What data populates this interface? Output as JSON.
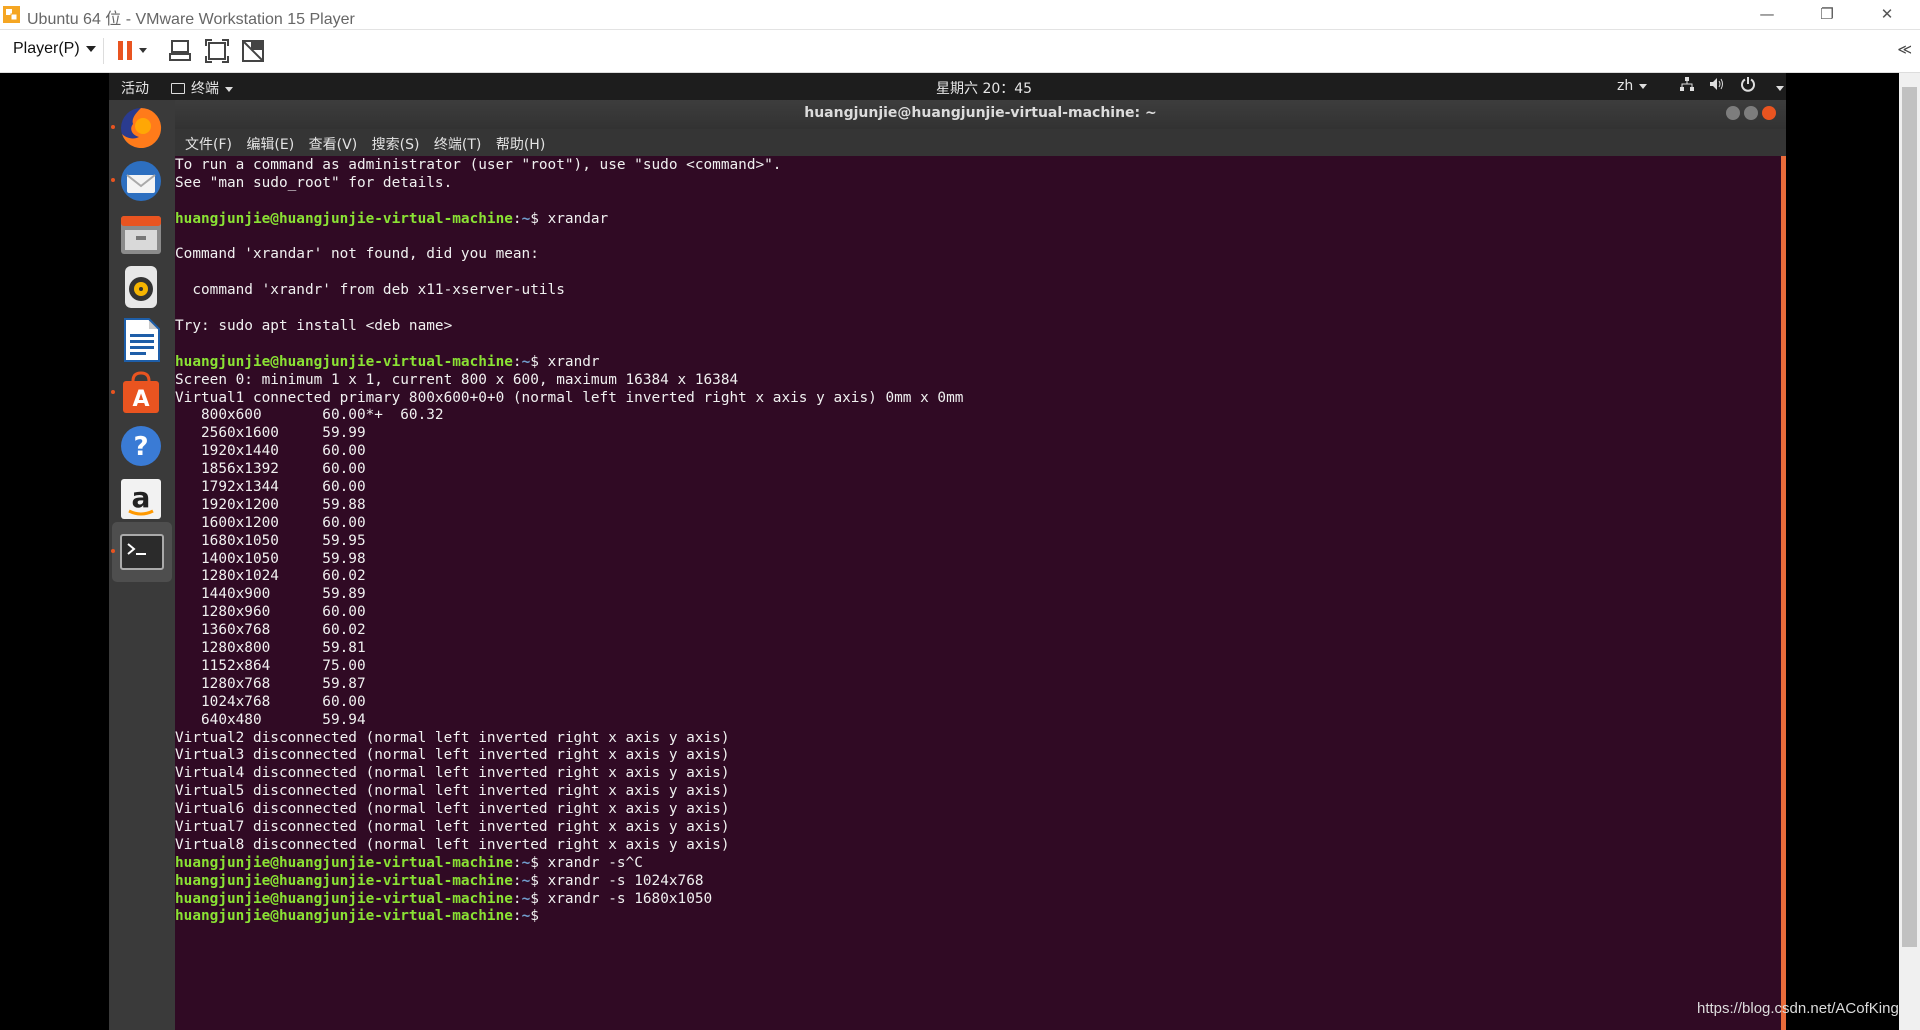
{
  "host": {
    "title": "Ubuntu 64 位 - VMware Workstation 15 Player",
    "player_menu": "Player(P)",
    "win_minimize": "—",
    "win_restore": "❐",
    "win_close": "✕",
    "collapse": "≪"
  },
  "topbar": {
    "activities": "活动",
    "app": "终端",
    "clock": "星期六 20：45",
    "lang": "zh"
  },
  "dock": [
    "firefox-icon",
    "thunderbird-icon",
    "files-icon",
    "rhythmbox-icon",
    "libreoffice-writer-icon",
    "software-center-icon",
    "help-icon",
    "amazon-icon",
    "terminal-icon"
  ],
  "terminal": {
    "title": "huangjunjie@huangjunjie-virtual-machine: ~",
    "menu": [
      "文件(F)",
      "编辑(E)",
      "查看(V)",
      "搜索(S)",
      "终端(T)",
      "帮助(H)"
    ],
    "user_host": "huangjunjie@huangjunjie-virtual-machine",
    "path": "~",
    "lines": [
      {
        "text": "To run a command as administrator (user \"root\"), use \"sudo <command>\"."
      },
      {
        "text": "See \"man sudo_root\" for details."
      },
      {
        "text": ""
      },
      {
        "prompt": true,
        "text": "xrandar"
      },
      {
        "text": ""
      },
      {
        "text": "Command 'xrandar' not found, did you mean:"
      },
      {
        "text": ""
      },
      {
        "text": "  command 'xrandr' from deb x11-xserver-utils"
      },
      {
        "text": ""
      },
      {
        "text": "Try: sudo apt install <deb name>"
      },
      {
        "text": ""
      },
      {
        "prompt": true,
        "text": "xrandr"
      },
      {
        "text": "Screen 0: minimum 1 x 1, current 800 x 600, maximum 16384 x 16384"
      },
      {
        "text": "Virtual1 connected primary 800x600+0+0 (normal left inverted right x axis y axis) 0mm x 0mm"
      },
      {
        "text": "   800x600       60.00*+  60.32"
      },
      {
        "text": "   2560x1600     59.99"
      },
      {
        "text": "   1920x1440     60.00"
      },
      {
        "text": "   1856x1392     60.00"
      },
      {
        "text": "   1792x1344     60.00"
      },
      {
        "text": "   1920x1200     59.88"
      },
      {
        "text": "   1600x1200     60.00"
      },
      {
        "text": "   1680x1050     59.95"
      },
      {
        "text": "   1400x1050     59.98"
      },
      {
        "text": "   1280x1024     60.02"
      },
      {
        "text": "   1440x900      59.89"
      },
      {
        "text": "   1280x960      60.00"
      },
      {
        "text": "   1360x768      60.02"
      },
      {
        "text": "   1280x800      59.81"
      },
      {
        "text": "   1152x864      75.00"
      },
      {
        "text": "   1280x768      59.87"
      },
      {
        "text": "   1024x768      60.00"
      },
      {
        "text": "   640x480       59.94"
      },
      {
        "text": "Virtual2 disconnected (normal left inverted right x axis y axis)"
      },
      {
        "text": "Virtual3 disconnected (normal left inverted right x axis y axis)"
      },
      {
        "text": "Virtual4 disconnected (normal left inverted right x axis y axis)"
      },
      {
        "text": "Virtual5 disconnected (normal left inverted right x axis y axis)"
      },
      {
        "text": "Virtual6 disconnected (normal left inverted right x axis y axis)"
      },
      {
        "text": "Virtual7 disconnected (normal left inverted right x axis y axis)"
      },
      {
        "text": "Virtual8 disconnected (normal left inverted right x axis y axis)"
      },
      {
        "prompt": true,
        "text": "xrandr -s^C"
      },
      {
        "prompt": true,
        "text": "xrandr -s 1024x768"
      },
      {
        "prompt": true,
        "text": "xrandr -s 1680x1050"
      },
      {
        "prompt": true,
        "text": ""
      }
    ]
  },
  "watermark": "https://blog.csdn.net/ACofKing",
  "colors": {
    "terminal_bg": "#300a24",
    "prompt_user": "#8ae234",
    "prompt_path": "#729fcf",
    "accent": "#e95420"
  }
}
